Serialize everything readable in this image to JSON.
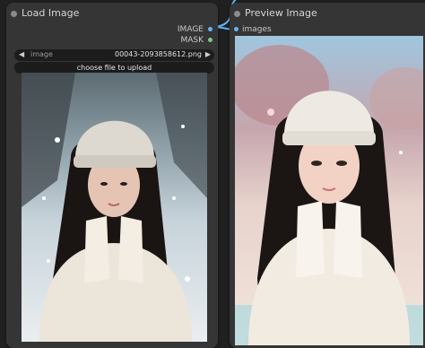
{
  "load_image_node": {
    "title": "Load Image",
    "outputs": [
      {
        "label": "IMAGE",
        "color": "#64b5f6"
      },
      {
        "label": "MASK",
        "color": "#81c784"
      }
    ],
    "image_widget": {
      "name": "image",
      "value": "00043-2093858612.png"
    },
    "upload_button_label": "choose file to upload"
  },
  "preview_image_node": {
    "title": "Preview Image",
    "input_label": "images"
  },
  "colors": {
    "canvas": "#202020",
    "node_body": "#353535",
    "widget_bg": "#1c1c1c",
    "link_wire": "#64b5f6"
  }
}
